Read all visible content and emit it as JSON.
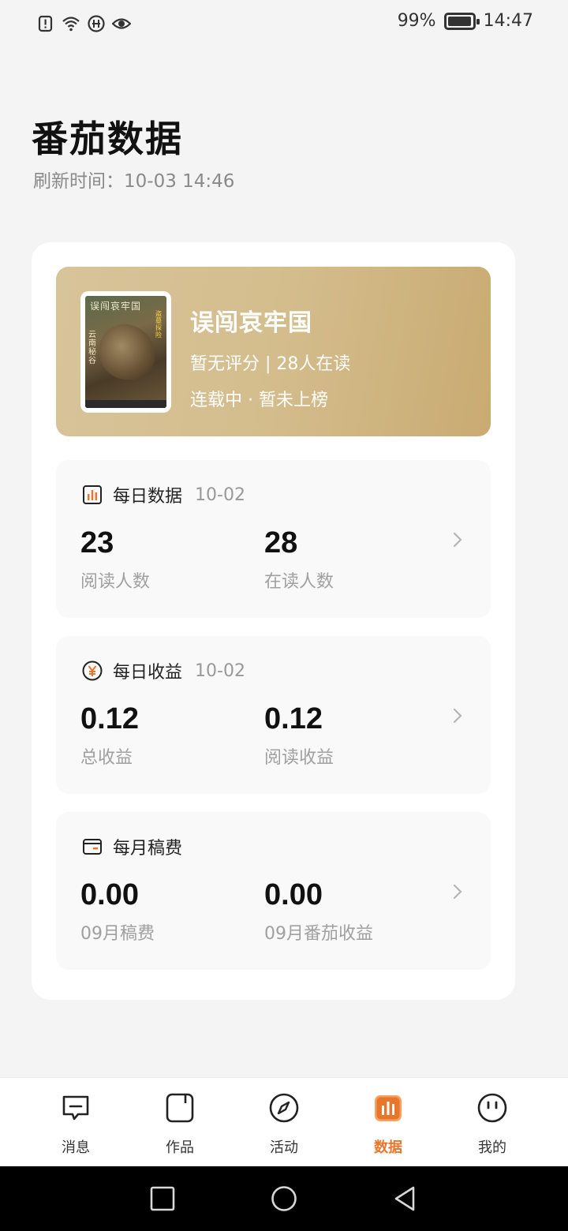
{
  "status_bar": {
    "battery_percent": "99%",
    "battery_level": 0.99,
    "time": "14:47",
    "icons": [
      "alert-icon",
      "wifi-icon",
      "data-icon",
      "eye-icon"
    ]
  },
  "header": {
    "title": "番茄数据",
    "refresh_time": "刷新时间：10-03 14:46"
  },
  "book": {
    "title": "误闯哀牢国",
    "meta": "暂无评分 | 28人在读",
    "status": "连载中 · 暂未上榜",
    "cover_title": "误闯哀牢国",
    "cover_subtitle": "云南秘谷",
    "cover_side_text": "盗墓探险"
  },
  "daily_data": {
    "title": "每日数据",
    "date": "10-02",
    "icon": "bar-chart-icon",
    "metrics": [
      {
        "value": "23",
        "label": "阅读人数"
      },
      {
        "value": "28",
        "label": "在读人数"
      }
    ]
  },
  "daily_income": {
    "title": "每日收益",
    "date": "10-02",
    "icon": "yen-icon",
    "metrics": [
      {
        "value": "0.12",
        "label": "总收益"
      },
      {
        "value": "0.12",
        "label": "阅读收益"
      }
    ]
  },
  "monthly_fee": {
    "title": "每月稿费",
    "icon": "wallet-icon",
    "metrics": [
      {
        "value": "0.00",
        "label": "09月稿费"
      },
      {
        "value": "0.00",
        "label": "09月番茄收益"
      }
    ]
  },
  "bottom_nav": {
    "items": [
      {
        "label": "消息",
        "icon": "message-icon"
      },
      {
        "label": "作品",
        "icon": "works-icon"
      },
      {
        "label": "活动",
        "icon": "compass-icon"
      },
      {
        "label": "数据",
        "icon": "data-icon",
        "active": true
      },
      {
        "label": "我的",
        "icon": "profile-icon"
      }
    ]
  },
  "colors": {
    "accent": "#e8762d",
    "book_card_bg": "#d4bd8d",
    "background": "#f4f4f4"
  }
}
